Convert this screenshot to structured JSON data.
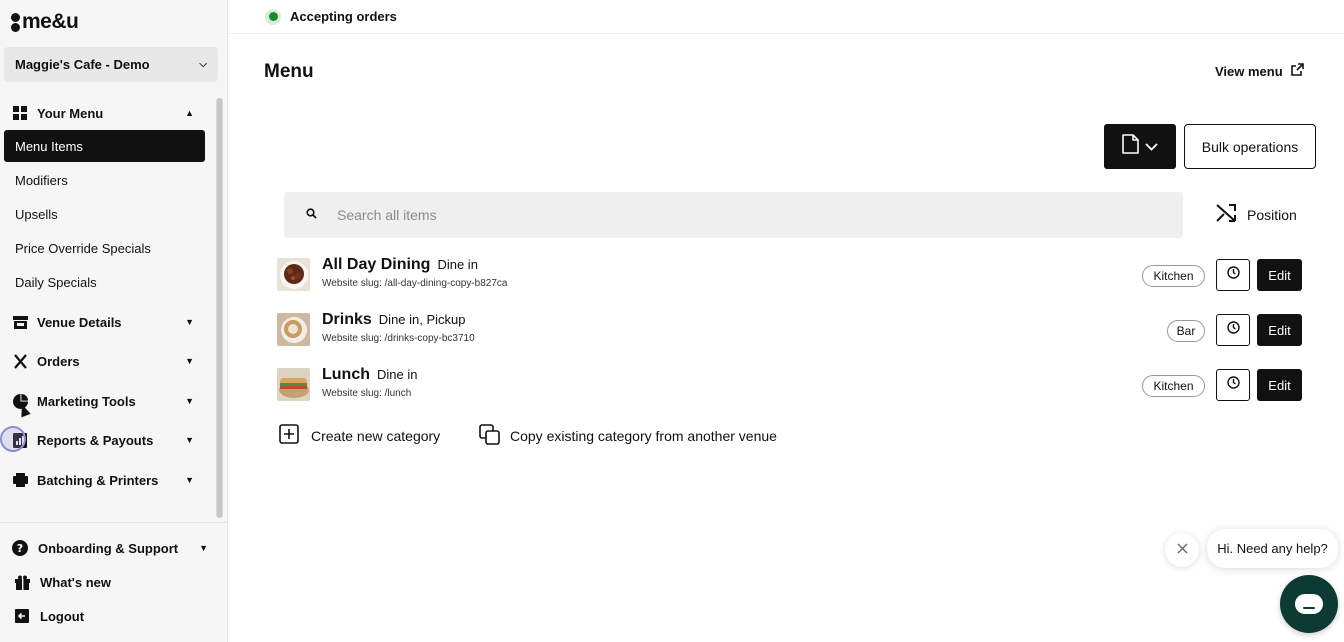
{
  "brand": {
    "logo_text": "me&u"
  },
  "venue": {
    "selected": "Maggie's Cafe - Demo"
  },
  "sidebar": {
    "sections": [
      {
        "label": "Your Menu",
        "icon": "grid-icon",
        "expanded": true
      },
      {
        "label": "Venue Details",
        "icon": "storefront-icon"
      },
      {
        "label": "Orders",
        "icon": "utensils-icon"
      },
      {
        "label": "Marketing Tools",
        "icon": "pie-chart-icon"
      },
      {
        "label": "Reports & Payouts",
        "icon": "report-icon"
      },
      {
        "label": "Batching & Printers",
        "icon": "printer-icon"
      }
    ],
    "menu_items": [
      {
        "label": "Menu Items",
        "active": true
      },
      {
        "label": "Modifiers"
      },
      {
        "label": "Upsells"
      },
      {
        "label": "Price Override Specials"
      },
      {
        "label": "Daily Specials"
      }
    ],
    "bottom": [
      {
        "label": "Onboarding & Support",
        "icon": "help-icon"
      },
      {
        "label": "What's new",
        "icon": "gift-icon"
      },
      {
        "label": "Logout",
        "icon": "logout-icon"
      }
    ]
  },
  "topbar": {
    "status": "Accepting orders",
    "status_color": "#1b8a2a"
  },
  "main": {
    "title": "Menu",
    "view_menu": "View menu",
    "bulk_operations": "Bulk operations",
    "search_placeholder": "Search all items",
    "position_label": "Position",
    "categories": [
      {
        "name": "All Day Dining",
        "modes": "Dine in",
        "slug": "Website slug: /all-day-dining-copy-b827ca",
        "tag": "Kitchen",
        "edit": "Edit"
      },
      {
        "name": "Drinks",
        "modes": "Dine in, Pickup",
        "slug": "Website slug: /drinks-copy-bc3710",
        "tag": "Bar",
        "edit": "Edit"
      },
      {
        "name": "Lunch",
        "modes": "Dine in",
        "slug": "Website slug: /lunch",
        "tag": "Kitchen",
        "edit": "Edit"
      }
    ],
    "create_category": "Create new category",
    "copy_category": "Copy existing category from another venue"
  },
  "chat": {
    "prompt": "Hi. Need any help?"
  },
  "colors": {
    "accent": "#111111",
    "chat_launcher": "#0d3b34"
  }
}
